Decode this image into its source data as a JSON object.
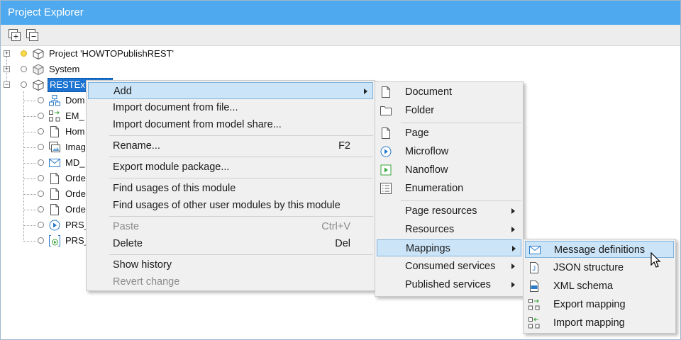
{
  "window": {
    "title": "Project Explorer"
  },
  "toolbar": {
    "expand_all_icon": "expand-all-icon",
    "collapse_all_icon": "collapse-all-icon"
  },
  "tree": {
    "project": "Project 'HOWTOPublishREST'",
    "system": "System",
    "module": "RESTEx",
    "children": [
      "Dom",
      "EM_",
      "Hom",
      "Imag",
      "MD_",
      "Orde",
      "Orde",
      "Orde",
      "PRS_",
      "PRS_"
    ]
  },
  "context_menu": {
    "add": "Add",
    "import_file": "Import document from file...",
    "import_share": "Import document from model share...",
    "rename": "Rename...",
    "rename_shortcut": "F2",
    "export": "Export module package...",
    "find_usages": "Find usages of this module",
    "find_other": "Find usages of other user modules by this module",
    "paste": "Paste",
    "paste_shortcut": "Ctrl+V",
    "delete": "Delete",
    "delete_shortcut": "Del",
    "show_history": "Show history",
    "revert": "Revert change"
  },
  "add_menu": {
    "document": "Document",
    "folder": "Folder",
    "page": "Page",
    "microflow": "Microflow",
    "nanoflow": "Nanoflow",
    "enumeration": "Enumeration",
    "page_resources": "Page resources",
    "resources": "Resources",
    "mappings": "Mappings",
    "consumed": "Consumed services",
    "published": "Published services"
  },
  "mappings_menu": {
    "message_definitions": "Message definitions",
    "json_structure": "JSON structure",
    "xml_schema": "XML schema",
    "export_mapping": "Export mapping",
    "import_mapping": "Import mapping"
  },
  "colors": {
    "titlebar": "#4fa9ee",
    "selection": "#1c73d2",
    "menu_highlight": "#cce4f7"
  }
}
